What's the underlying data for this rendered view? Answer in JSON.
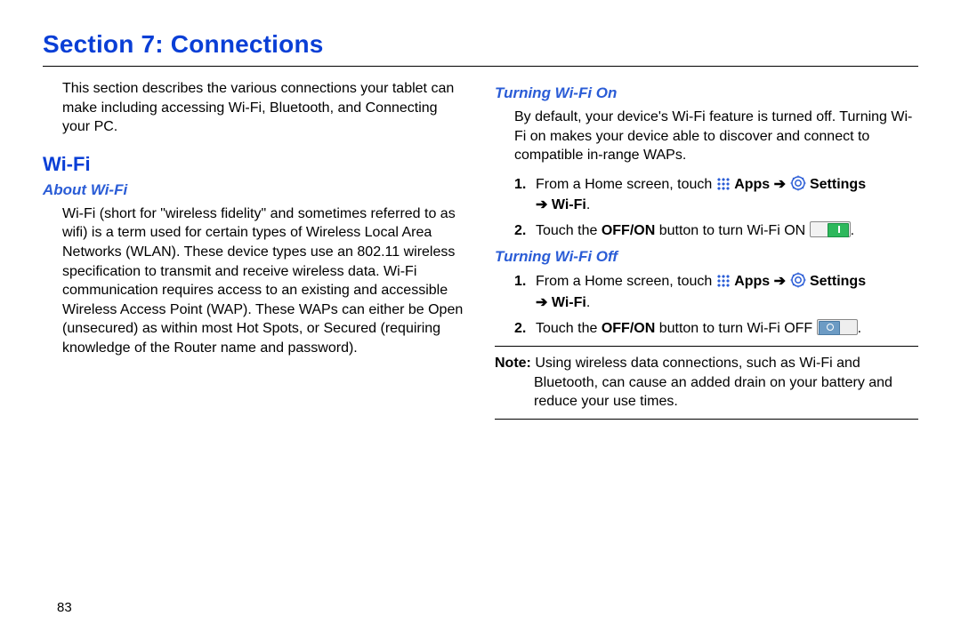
{
  "title": "Section 7: Connections",
  "intro": "This section describes the various connections your tablet can make including accessing Wi-Fi, Bluetooth, and Connecting your PC.",
  "left": {
    "h2": "Wi-Fi",
    "h3": "About Wi-Fi",
    "para": "Wi-Fi (short for \"wireless fidelity\" and sometimes referred to as wifi) is a term used for certain types of Wireless Local Area Networks (WLAN). These device types use an 802.11 wireless specification to transmit and receive wireless data. Wi-Fi communication requires access to an existing and accessible Wireless Access Point (WAP). These WAPs can either be Open (unsecured) as within most Hot Spots, or Secured (requiring knowledge of the Router name and password)."
  },
  "right": {
    "on": {
      "h3": "Turning Wi-Fi On",
      "para": "By default, your device's Wi-Fi feature is turned off. Turning Wi-Fi on makes your device able to discover and connect to compatible in-range WAPs.",
      "step1": {
        "num": "1.",
        "pre": "From a Home screen, touch ",
        "apps": "Apps",
        "arrow1": " ➔ ",
        "settings": "Settings",
        "arrow2": "➔ ",
        "wifi": "Wi-Fi",
        "post": "."
      },
      "step2": {
        "num": "2.",
        "pre": "Touch the ",
        "btn": "OFF/ON",
        "mid": " button to turn Wi-Fi ON ",
        "post": "."
      }
    },
    "off": {
      "h3": "Turning Wi-Fi Off",
      "step1": {
        "num": "1.",
        "pre": "From a Home screen, touch ",
        "apps": "Apps",
        "arrow1": " ➔ ",
        "settings": "Settings",
        "arrow2": "➔ ",
        "wifi": "Wi-Fi",
        "post": "."
      },
      "step2": {
        "num": "2.",
        "pre": "Touch the ",
        "btn": "OFF/ON",
        "mid": " button to turn Wi-Fi OFF ",
        "post": "."
      }
    },
    "note": {
      "label": "Note:",
      "line1": " Using wireless data connections, such as Wi-Fi and",
      "line2": "Bluetooth, can cause an added drain on your battery and reduce your use times."
    }
  },
  "pagenum": "83"
}
